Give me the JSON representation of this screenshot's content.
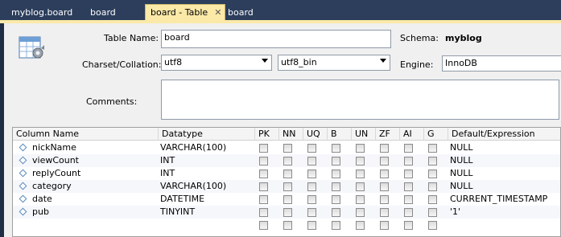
{
  "tabs": [
    {
      "label": "myblog.board"
    },
    {
      "label": "board"
    },
    {
      "label": "board - Table",
      "close": "✕"
    },
    {
      "label": "board"
    }
  ],
  "form": {
    "table_name_label": "Table Name:",
    "table_name_value": "board",
    "schema_label": "Schema:",
    "schema_value": "myblog",
    "charset_label": "Charset/Collation:",
    "charset_value": "utf8",
    "collation_value": "utf8_bin",
    "engine_label": "Engine:",
    "engine_value": "InnoDB",
    "comments_label": "Comments:",
    "comments_value": ""
  },
  "grid": {
    "headers": {
      "column_name": "Column Name",
      "datatype": "Datatype",
      "pk": "PK",
      "nn": "NN",
      "uq": "UQ",
      "b": "B",
      "un": "UN",
      "zf": "ZF",
      "ai": "AI",
      "g": "G",
      "default": "Default/Expression"
    },
    "rows": [
      {
        "name": "nickName",
        "type": "VARCHAR(100)",
        "default": "NULL"
      },
      {
        "name": "viewCount",
        "type": "INT",
        "default": "NULL"
      },
      {
        "name": "replyCount",
        "type": "INT",
        "default": "NULL"
      },
      {
        "name": "category",
        "type": "VARCHAR(100)",
        "default": "NULL"
      },
      {
        "name": "date",
        "type": "DATETIME",
        "default": "CURRENT_TIMESTAMP"
      },
      {
        "name": "pub",
        "type": "TINYINT",
        "default": "'1'"
      }
    ]
  },
  "icons": {
    "table_editor": "table-gear-icon",
    "column": "diamond-column-icon",
    "dropdown": "chevron-down-icon"
  }
}
